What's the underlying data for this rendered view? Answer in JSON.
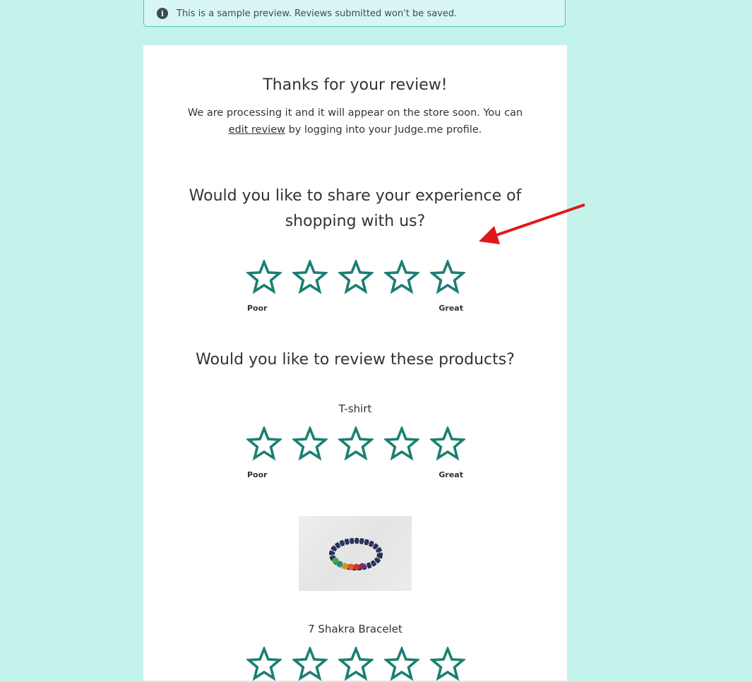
{
  "banner": {
    "icon": "info-icon",
    "text": "This is a sample preview. Reviews submitted won't be saved."
  },
  "thanks": {
    "title": "Thanks for your review!",
    "body_before": "We are processing it and it will appear on the store soon. You can",
    "link": "edit review",
    "body_after": "by logging into your Judge.me profile."
  },
  "shop_question": {
    "text": "Would you like to share your experience of shopping with us?",
    "rating_value": 0,
    "rating_max": 5,
    "low_label": "Poor",
    "high_label": "Great"
  },
  "products_question": "Would you like to review these products?",
  "products": [
    {
      "name": "T-shirt",
      "rating_value": 0,
      "rating_max": 5,
      "low_label": "Poor",
      "high_label": "Great"
    },
    {
      "name": "7 Shakra Bracelet",
      "image": "bracelet-photo",
      "rating_value": 0,
      "rating_max": 5
    }
  ],
  "colors": {
    "page_background": "#c4f3ec",
    "star_outline": "#1a7f72",
    "annotation_arrow": "#e0181b"
  }
}
